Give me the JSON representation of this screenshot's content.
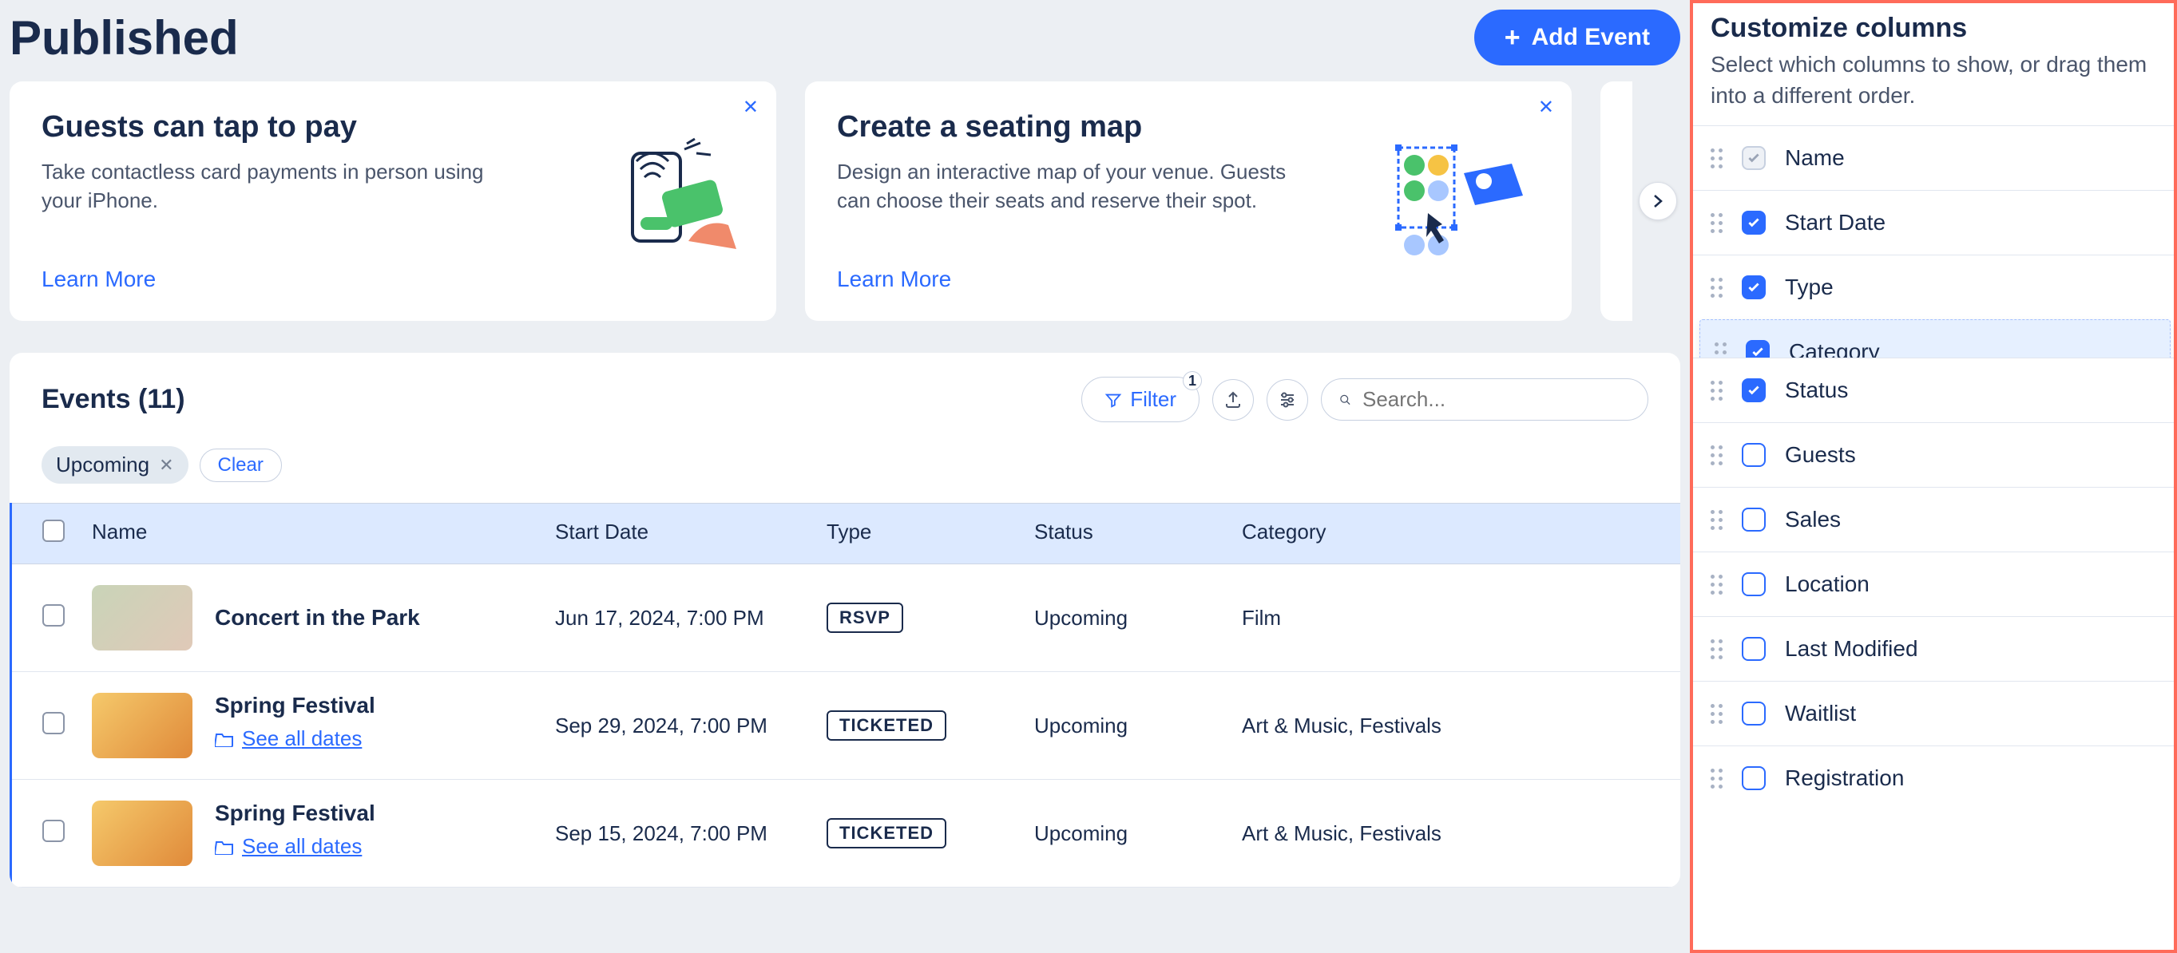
{
  "page": {
    "title": "Published"
  },
  "header": {
    "add_event": "Add Event"
  },
  "cards": [
    {
      "title": "Guests can tap to pay",
      "desc": "Take contactless card payments in person using your iPhone.",
      "link": "Learn More"
    },
    {
      "title": "Create a seating map",
      "desc": "Design an interactive map of your venue. Guests can choose their seats and reserve their spot.",
      "link": "Learn More"
    }
  ],
  "events": {
    "title": "Events (11)",
    "filter_label": "Filter",
    "filter_count": "1",
    "search_placeholder": "Search...",
    "active_filter": "Upcoming",
    "clear_label": "Clear",
    "columns": [
      "Name",
      "Start Date",
      "Type",
      "Status",
      "Category"
    ],
    "rows": [
      {
        "name": "Concert in the Park",
        "start": "Jun 17, 2024, 7:00 PM",
        "type": "RSVP",
        "status": "Upcoming",
        "category": "Film",
        "has_dates": false,
        "thumb": "park"
      },
      {
        "name": "Spring Festival",
        "start": "Sep 29, 2024, 7:00 PM",
        "type": "TICKETED",
        "status": "Upcoming",
        "category": "Art & Music, Festivals",
        "has_dates": true,
        "thumb": "fest"
      },
      {
        "name": "Spring Festival",
        "start": "Sep 15, 2024, 7:00 PM",
        "type": "TICKETED",
        "status": "Upcoming",
        "category": "Art & Music, Festivals",
        "has_dates": true,
        "thumb": "fest"
      }
    ],
    "see_all_dates": "See all dates"
  },
  "customize": {
    "title": "Customize columns",
    "sub": "Select which columns to show, or drag them into a different order.",
    "items": [
      {
        "label": "Name",
        "checked": true,
        "locked": true
      },
      {
        "label": "Start Date",
        "checked": true
      },
      {
        "label": "Type",
        "checked": true
      },
      {
        "label": "Category",
        "checked": true,
        "dragging": true
      },
      {
        "label": "Status",
        "checked": true,
        "overlap": true
      },
      {
        "label": "Guests",
        "checked": false
      },
      {
        "label": "Sales",
        "checked": false
      },
      {
        "label": "Location",
        "checked": false
      },
      {
        "label": "Last Modified",
        "checked": false
      },
      {
        "label": "Waitlist",
        "checked": false
      },
      {
        "label": "Registration",
        "checked": false
      }
    ]
  }
}
